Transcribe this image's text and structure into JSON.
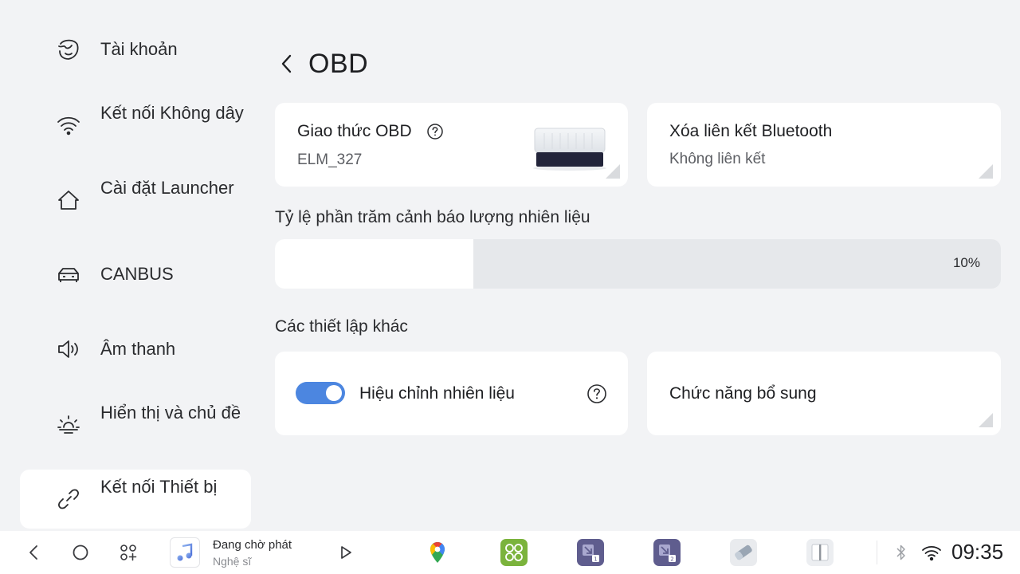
{
  "sidebar": {
    "items": [
      {
        "label": "Tài khoản",
        "icon": "account-icon"
      },
      {
        "label": "Kết nối Không dây",
        "icon": "wifi-icon"
      },
      {
        "label": "Cài đặt Launcher",
        "icon": "home-icon"
      },
      {
        "label": "CANBUS",
        "icon": "car-icon"
      },
      {
        "label": "Âm thanh",
        "icon": "speaker-icon"
      },
      {
        "label": "Hiển thị và chủ đề",
        "icon": "brightness-icon"
      },
      {
        "label": "Kết nối Thiết bị",
        "icon": "link-icon",
        "active": true
      }
    ]
  },
  "header": {
    "title": "OBD",
    "back_icon": "chevron-left-icon"
  },
  "obd_protocol": {
    "title": "Giao thức OBD",
    "value": "ELM_327",
    "help_icon": "help-circle-icon"
  },
  "bluetooth_unlink": {
    "title": "Xóa liên kết Bluetooth",
    "value": "Không liên kết"
  },
  "fuel_warning": {
    "label": "Tỷ lệ phần trăm cảnh báo lượng nhiên liệu",
    "value_text": "10%",
    "value": 10
  },
  "other_settings": {
    "label": "Các thiết lập khác"
  },
  "fuel_calibration": {
    "label": "Hiệu chỉnh nhiên liệu",
    "enabled": true
  },
  "extra_functions": {
    "label": "Chức năng bổ sung"
  },
  "taskbar": {
    "media_title": "Đang chờ phát",
    "media_artist": "Nghệ sĩ",
    "time": "09:35"
  },
  "colors": {
    "accent": "#4c86e0",
    "background": "#f2f3f5",
    "card": "#ffffff"
  }
}
